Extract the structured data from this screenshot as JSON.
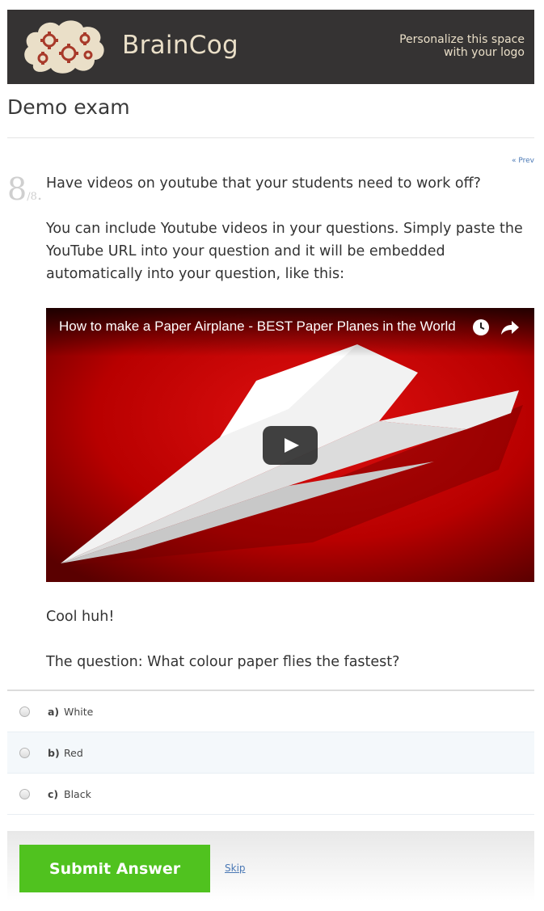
{
  "header": {
    "brand_name": "BrainCog",
    "tagline_line1": "Personalize this space",
    "tagline_line2": "with your logo",
    "colors": {
      "banner_bg": "#353333",
      "brand_text": "#eadfc8",
      "logo_cloud": "#eadfc8",
      "logo_gears": "#a83a2a"
    }
  },
  "exam": {
    "title": "Demo exam",
    "prev_link": "« Prev"
  },
  "question": {
    "number": "8",
    "total": "/8",
    "dot": ".",
    "intro": "Have videos on youtube that your students need to work off?",
    "body": "You can include Youtube videos in your questions. Simply paste the YouTube URL into your question and it will be embedded automatically into your question, like this:",
    "after_video": "Cool huh!",
    "prompt": "The question: What colour paper flies the fastest?"
  },
  "video": {
    "title": "How to make a Paper Airplane - BEST Paper Planes in the World",
    "icons": [
      "clock-icon",
      "share-icon",
      "play-icon"
    ]
  },
  "answers": [
    {
      "letter": "a)",
      "text": "White"
    },
    {
      "letter": "b)",
      "text": "Red"
    },
    {
      "letter": "c)",
      "text": "Black"
    }
  ],
  "actions": {
    "submit_label": "Submit Answer",
    "skip_label": "Skip",
    "submit_color": "#50c21f"
  }
}
